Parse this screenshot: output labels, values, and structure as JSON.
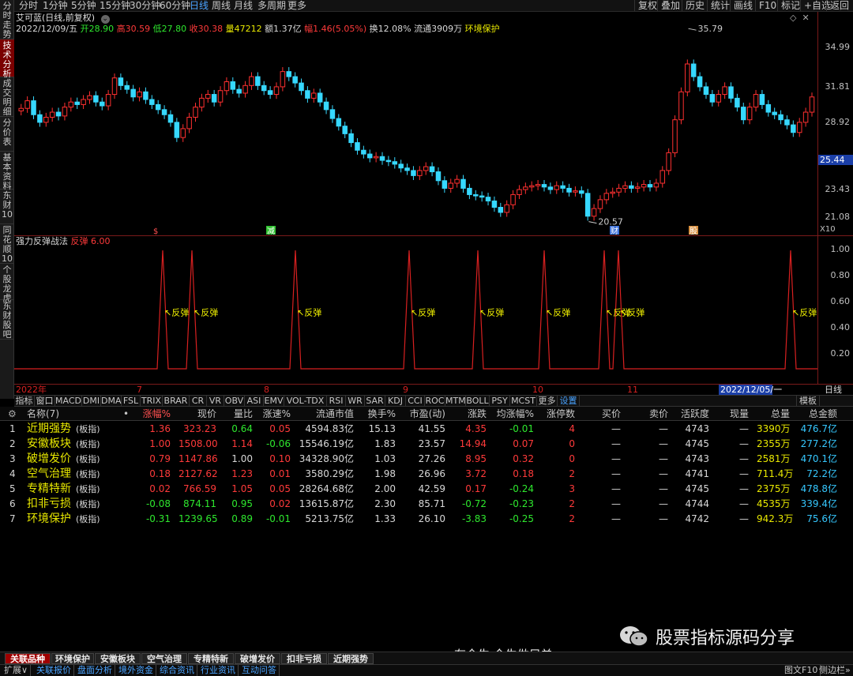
{
  "left_tabs": [
    "分时走势",
    "技术分析",
    "成交明细",
    "分价表",
    "基本资料",
    "东财10",
    "同花顺10",
    "个股龙虎",
    "东财股吧"
  ],
  "periods": [
    "分时",
    "1分钟",
    "5分钟",
    "15分钟",
    "30分钟",
    "60分钟",
    "日线",
    "周线",
    "月线",
    "多周期",
    "更多"
  ],
  "right_buttons": [
    "复权",
    "叠加",
    "历史",
    "统计",
    "画线",
    "F10",
    "标记",
    "+自选",
    "返回"
  ],
  "stock": {
    "title": "艾可蓝(日线,前复权)",
    "date": "2022/12/09/五",
    "open_label": "开",
    "open": "28.90",
    "high_label": "高",
    "high": "30.59",
    "low_label": "低",
    "low": "27.80",
    "close_label": "收",
    "close": "30.38",
    "vol_label": "量",
    "vol": "47212",
    "amount_label": "额",
    "amount": "1.37亿",
    "chg_label": "幅",
    "chg": "1.46(5.05%)",
    "turnover_label": "换",
    "turnover": "12.08%",
    "float_label": "流通",
    "float": "3909万",
    "concept": "环境保护"
  },
  "price_axis": [
    "34.99",
    "31.81",
    "28.92",
    "25.44",
    "23.43",
    "21.08"
  ],
  "price_high": "35.79",
  "price_low": "20.57",
  "current_price": "25.44",
  "x_label": "X10",
  "markers": [
    {
      "text": "$",
      "color": "#ff5050"
    },
    {
      "text": "减",
      "color": "#2ec02e"
    },
    {
      "text": "财",
      "color": "#3a6fd8"
    },
    {
      "text": "股",
      "color": "#d89040"
    }
  ],
  "indicator": {
    "name": "强力反弹战法",
    "signal_name": "反弹",
    "signal_value": "6.00",
    "signal_text": "反弹",
    "axis": [
      "1.00",
      "0.80",
      "0.60",
      "0.40",
      "0.20"
    ]
  },
  "date_axis": {
    "labels": [
      "2022年",
      "7",
      "8",
      "9",
      "10",
      "11"
    ],
    "cursor": "2022/12/05/一",
    "period": "日线"
  },
  "indicator_tabs": [
    "指标",
    "窗口",
    "MACD",
    "DMI",
    "DMA",
    "FSL",
    "TRIX",
    "BRAR",
    "CR",
    "VR",
    "OBV",
    "ASI",
    "EMV",
    "VOL-TDX",
    "RSI",
    "WR",
    "SAR",
    "KDJ",
    "CCI",
    "ROC",
    "MTM",
    "BOLL",
    "PSY",
    "MCST",
    "更多",
    "设置",
    "模板"
  ],
  "table": {
    "headers": [
      "名称(7)",
      "•",
      "涨幅%",
      "现价",
      "量比",
      "涨速%",
      "流通市值",
      "换手%",
      "市盈(动)",
      "涨跌",
      "均涨幅%",
      "涨停数",
      "买价",
      "卖价",
      "活跃度",
      "现量",
      "总量",
      "总金额"
    ],
    "rows": [
      {
        "idx": "1",
        "name": "近期强势",
        "tag": "(板指)",
        "chg": "1.36",
        "price": "323.23",
        "vr": "0.64",
        "speed": "0.05",
        "mcap": "4594.83亿",
        "turn": "15.13",
        "pe": "41.55",
        "diff": "4.35",
        "avg": "-0.01",
        "limit": "4",
        "bid": "—",
        "ask": "—",
        "act": "4743",
        "cur": "—",
        "vol": "3390万",
        "amt": "476.7亿"
      },
      {
        "idx": "2",
        "name": "安徽板块",
        "tag": "(板指)",
        "chg": "1.00",
        "price": "1508.00",
        "vr": "1.14",
        "speed": "-0.06",
        "mcap": "15546.19亿",
        "turn": "1.83",
        "pe": "23.57",
        "diff": "14.94",
        "avg": "0.07",
        "limit": "0",
        "bid": "—",
        "ask": "—",
        "act": "4745",
        "cur": "—",
        "vol": "2355万",
        "amt": "277.2亿"
      },
      {
        "idx": "3",
        "name": "破增发价",
        "tag": "(板指)",
        "chg": "0.79",
        "price": "1147.86",
        "vr": "1.00",
        "speed": "0.10",
        "mcap": "34328.90亿",
        "turn": "1.03",
        "pe": "27.26",
        "diff": "8.95",
        "avg": "0.32",
        "limit": "0",
        "bid": "—",
        "ask": "—",
        "act": "4743",
        "cur": "—",
        "vol": "2581万",
        "amt": "470.1亿"
      },
      {
        "idx": "4",
        "name": "空气治理",
        "tag": "(板指)",
        "chg": "0.18",
        "price": "2127.62",
        "vr": "1.23",
        "speed": "0.01",
        "mcap": "3580.29亿",
        "turn": "1.98",
        "pe": "26.96",
        "diff": "3.72",
        "avg": "0.18",
        "limit": "2",
        "bid": "—",
        "ask": "—",
        "act": "4741",
        "cur": "—",
        "vol": "711.4万",
        "amt": "72.2亿"
      },
      {
        "idx": "5",
        "name": "专精特新",
        "tag": "(板指)",
        "chg": "0.02",
        "price": "766.59",
        "vr": "1.05",
        "speed": "0.05",
        "mcap": "28264.68亿",
        "turn": "2.00",
        "pe": "42.59",
        "diff": "0.17",
        "avg": "-0.24",
        "limit": "3",
        "bid": "—",
        "ask": "—",
        "act": "4745",
        "cur": "—",
        "vol": "2375万",
        "amt": "478.8亿"
      },
      {
        "idx": "6",
        "name": "扣非亏损",
        "tag": "(板指)",
        "chg": "-0.08",
        "price": "874.11",
        "vr": "0.95",
        "speed": "0.02",
        "mcap": "13615.87亿",
        "turn": "2.30",
        "pe": "85.71",
        "diff": "-0.72",
        "avg": "-0.23",
        "limit": "2",
        "bid": "—",
        "ask": "—",
        "act": "4744",
        "cur": "—",
        "vol": "4535万",
        "amt": "339.4亿"
      },
      {
        "idx": "7",
        "name": "环境保护",
        "tag": "(板指)",
        "chg": "-0.31",
        "price": "1239.65",
        "vr": "0.89",
        "speed": "-0.01",
        "mcap": "5213.75亿",
        "turn": "1.33",
        "pe": "26.10",
        "diff": "-3.83",
        "avg": "-0.25",
        "limit": "2",
        "bid": "—",
        "ask": "—",
        "act": "4742",
        "cur": "—",
        "vol": "942.3万",
        "amt": "75.6亿"
      }
    ]
  },
  "watermark": {
    "text": "股票指标源码分享",
    "signature": "有今生 今生做兄弟"
  },
  "bottom_tabs": [
    "关联品种",
    "环境保护",
    "安徽板块",
    "空气治理",
    "专精特新",
    "破增发价",
    "扣非亏损",
    "近期强势"
  ],
  "status_items": [
    "扩展∨",
    "关联报价",
    "盘面分析",
    "境外资金",
    "综合资讯",
    "行业资讯",
    "互动问答"
  ],
  "status_right": [
    "图文F10",
    "侧边栏»"
  ],
  "colors": {
    "up": "#ff3a3a",
    "down": "#2ee82e",
    "bull_candle": "#ff3030",
    "bear_candle": "#36d8ff",
    "frame": "#7a1a1a"
  }
}
